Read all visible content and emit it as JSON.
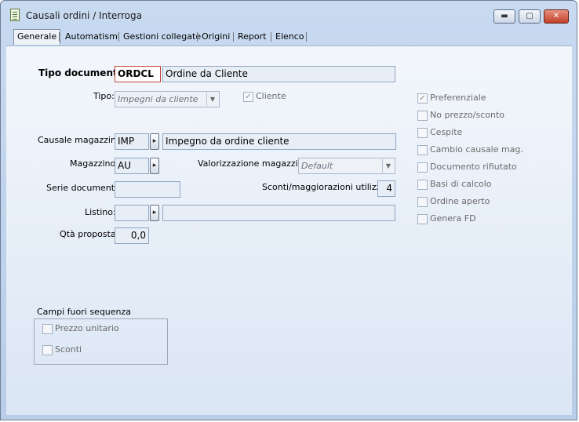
{
  "window": {
    "title": "Causali ordini / Interroga",
    "minimize": "▬",
    "maximize": "▢",
    "close": "✕"
  },
  "tabs": [
    "Generale",
    "Automatismi",
    "Gestioni collegate",
    "Origini",
    "Report",
    "Elenco"
  ],
  "active_tab": "Generale",
  "form": {
    "tipo_documento": {
      "label": "Tipo documento:",
      "code": "ORDCL",
      "description": "Ordine da Cliente"
    },
    "tipo": {
      "label": "Tipo:",
      "value": "Impegni da cliente"
    },
    "cliente": {
      "label": "Cliente",
      "checked": true
    },
    "causale_magazzino": {
      "label": "Causale magazzino:",
      "code": "IMP",
      "description": "Impegno da ordine cliente"
    },
    "magazzino": {
      "label": "Magazzino:",
      "code": "AU"
    },
    "valorizzazione_magazzino": {
      "label": "Valorizzazione magazzino:",
      "value": "Default"
    },
    "serie_documento": {
      "label": "Serie documento:",
      "value": ""
    },
    "sconti": {
      "label": "Sconti/maggiorazioni utilizzati:",
      "value": "4"
    },
    "listino": {
      "label": "Listino:",
      "code": "",
      "description": ""
    },
    "qta_proposta": {
      "label": "Qtà proposta:",
      "value": "0,0"
    }
  },
  "options": [
    {
      "label": "Preferenziale",
      "checked": true
    },
    {
      "label": "No prezzo/sconto",
      "checked": false
    },
    {
      "label": "Cespite",
      "checked": false
    },
    {
      "label": "Cambio causale mag.",
      "checked": false
    },
    {
      "label": "Documento rifiutato",
      "checked": false
    },
    {
      "label": "Basi di calcolo",
      "checked": false
    },
    {
      "label": "Ordine aperto",
      "checked": false
    },
    {
      "label": "Genera FD",
      "checked": false
    }
  ],
  "campi_fuori_sequenza": {
    "title": "Campi fuori sequenza",
    "items": [
      {
        "label": "Prezzo unitario",
        "checked": false
      },
      {
        "label": "Sconti",
        "checked": false
      }
    ]
  },
  "icons": {
    "zoom": "▸",
    "dropdown": "▼",
    "check": "✓"
  }
}
